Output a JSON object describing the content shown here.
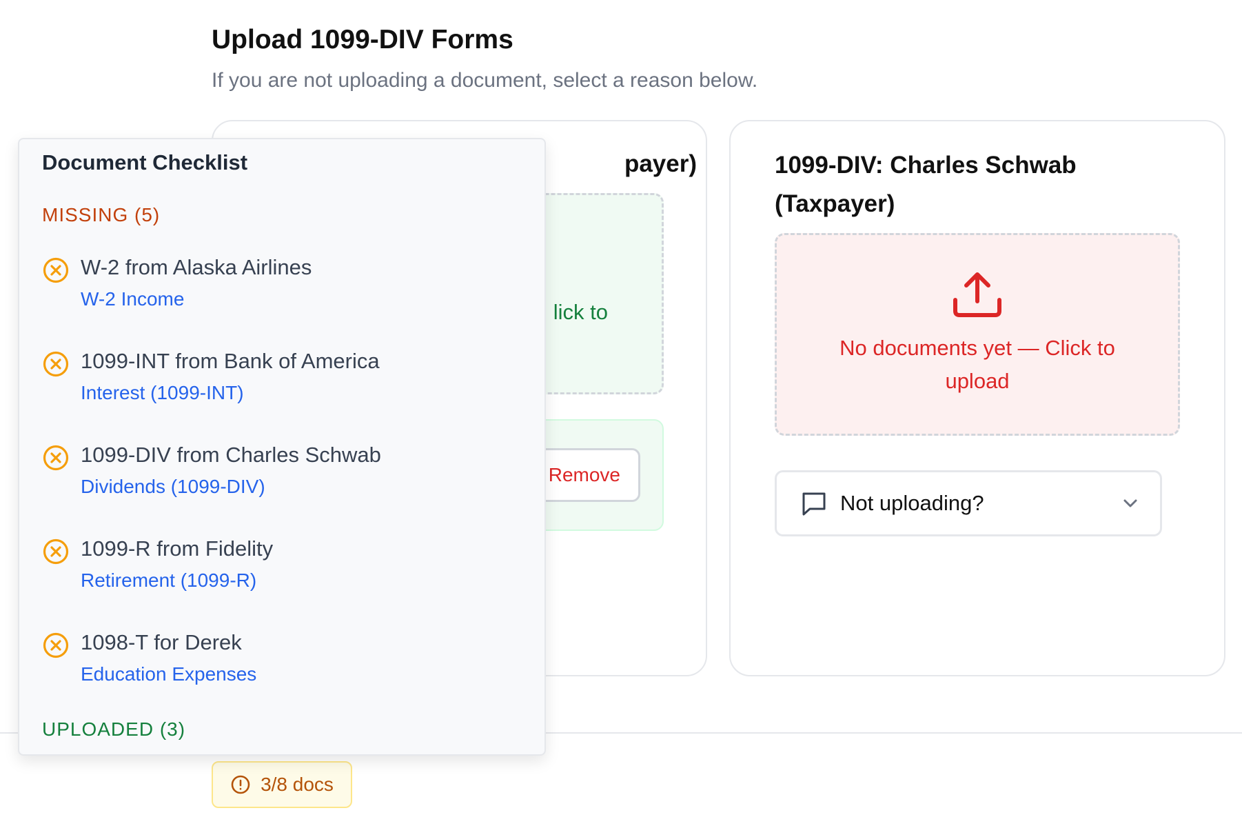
{
  "page": {
    "title": "Upload 1099-DIV Forms",
    "subtitle": "If you are not uploading a document, select a reason below."
  },
  "left_card": {
    "title_visible": "payer)",
    "dropzone_text_visible": "lick to",
    "remove_label": "Remove"
  },
  "right_card": {
    "title": "1099-DIV: Charles Schwab (Taxpayer)",
    "dropzone_text": "No documents yet — Click to upload",
    "not_uploading_label": "Not uploading?"
  },
  "status_badge": {
    "label": "3/8 docs"
  },
  "checklist": {
    "title": "Document Checklist",
    "missing_label": "MISSING (5)",
    "missing_items": [
      {
        "name": "W-2 from Alaska Airlines",
        "category": "W-2 Income"
      },
      {
        "name": "1099-INT from Bank of America",
        "category": "Interest (1099-INT)"
      },
      {
        "name": "1099-DIV from Charles Schwab",
        "category": "Dividends (1099-DIV)"
      },
      {
        "name": "1099-R from Fidelity",
        "category": "Retirement (1099-R)"
      },
      {
        "name": "1098-T for Derek",
        "category": "Education Expenses"
      }
    ],
    "uploaded_label": "UPLOADED (3)"
  },
  "colors": {
    "missing": "#f59e0b",
    "error": "#dc2626",
    "success": "#15803d",
    "link": "#2563eb"
  },
  "icons": {
    "missing_item": "x-circle-icon",
    "upload": "upload-icon",
    "not_uploading": "chat-bubble-icon",
    "dropdown": "chevron-down-icon",
    "badge": "alert-circle-icon"
  }
}
